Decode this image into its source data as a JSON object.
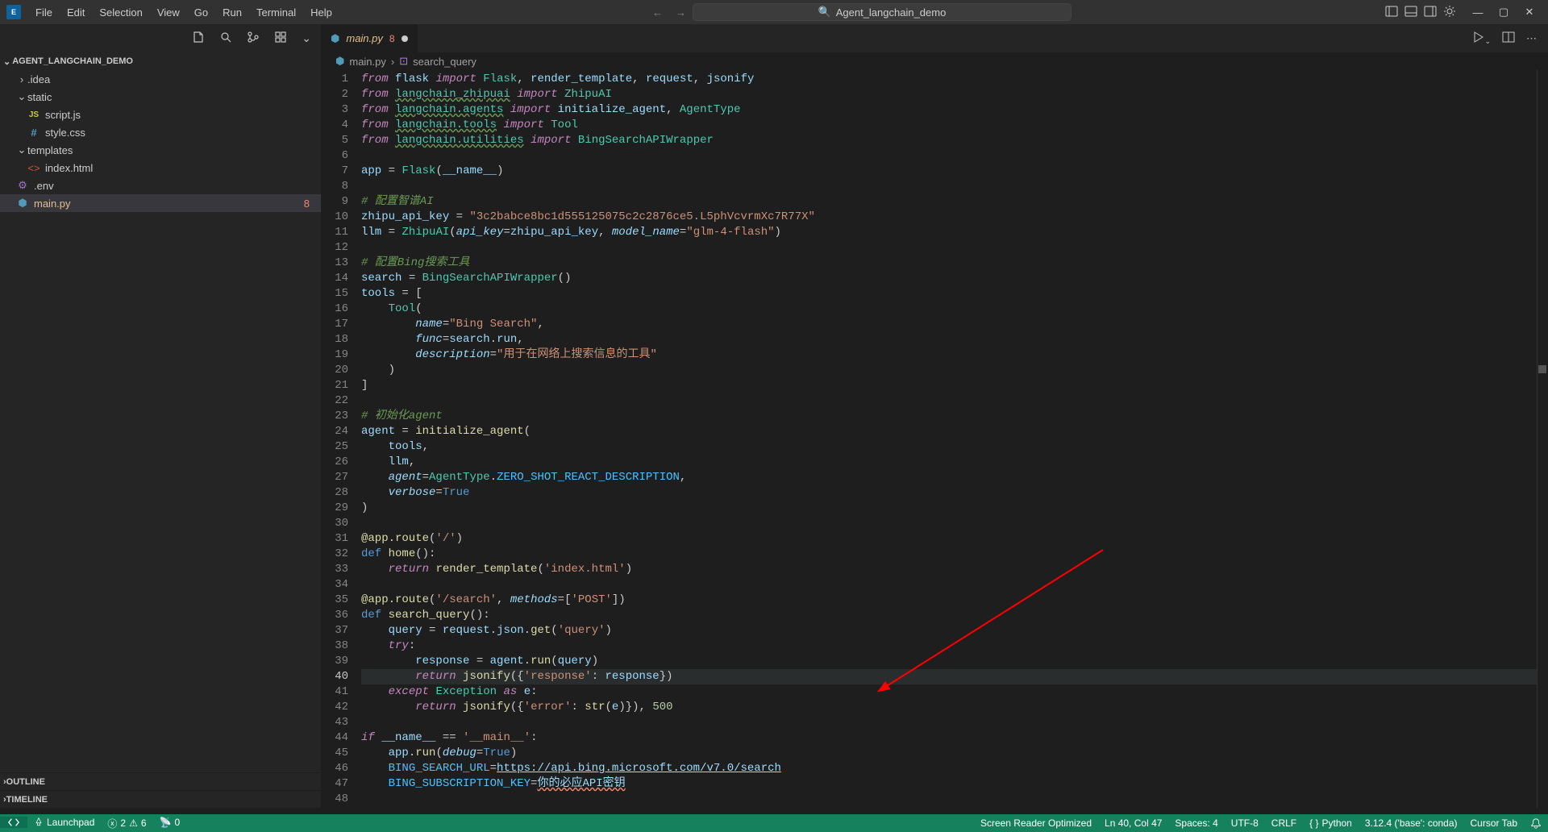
{
  "title_search": "Agent_langchain_demo",
  "menu": [
    "File",
    "Edit",
    "Selection",
    "View",
    "Go",
    "Run",
    "Terminal",
    "Help"
  ],
  "explorer": {
    "project": "AGENT_LANGCHAIN_DEMO",
    "tree": [
      {
        "label": ".idea",
        "type": "folder",
        "depth": 1,
        "open": false
      },
      {
        "label": "static",
        "type": "folder",
        "depth": 1,
        "open": true
      },
      {
        "label": "script.js",
        "type": "js",
        "depth": 2
      },
      {
        "label": "style.css",
        "type": "css",
        "depth": 2
      },
      {
        "label": "templates",
        "type": "folder",
        "depth": 1,
        "open": true
      },
      {
        "label": "index.html",
        "type": "html",
        "depth": 2
      },
      {
        "label": ".env",
        "type": "env",
        "depth": 1,
        "leaf": true
      },
      {
        "label": "main.py",
        "type": "py",
        "depth": 1,
        "leaf": true,
        "active": true,
        "badge": "8"
      }
    ],
    "outline": "OUTLINE",
    "timeline": "TIMELINE"
  },
  "tab": {
    "name": "main.py",
    "problems": "8"
  },
  "breadcrumb": {
    "file": "main.py",
    "symbol": "search_query"
  },
  "code": [
    {
      "n": 1,
      "h": "<span class='kw'>from</span> <span class='var'>flask</span> <span class='kw'>import</span> <span class='cls'>Flask</span>, <span class='var'>render_template</span>, <span class='var'>request</span>, <span class='var'>jsonify</span>"
    },
    {
      "n": 2,
      "h": "<span class='kw'>from</span> <span class='mod'>langchain_zhipuai</span> <span class='kw'>import</span> <span class='cls'>ZhipuAI</span>"
    },
    {
      "n": 3,
      "h": "<span class='kw'>from</span> <span class='mod'>langchain.agents</span> <span class='kw'>import</span> <span class='var'>initialize_agent</span>, <span class='cls'>AgentType</span>"
    },
    {
      "n": 4,
      "h": "<span class='kw'>from</span> <span class='mod'>langchain.tools</span> <span class='kw'>import</span> <span class='cls'>Tool</span>"
    },
    {
      "n": 5,
      "h": "<span class='kw'>from</span> <span class='mod'>langchain.utilities</span> <span class='kw'>import</span> <span class='cls'>BingSearchAPIWrapper</span>"
    },
    {
      "n": 6,
      "h": ""
    },
    {
      "n": 7,
      "h": "<span class='var'>app</span> = <span class='cls'>Flask</span>(<span class='var'>__name__</span>)"
    },
    {
      "n": 8,
      "h": ""
    },
    {
      "n": 9,
      "h": "<span class='com'># 配置智谱AI</span>"
    },
    {
      "n": 10,
      "h": "<span class='var'>zhipu_api_key</span> = <span class='str'>\"3c2babce8bc1d555125075c2c2876ce5.L5phVcvrmXc7R77X\"</span>"
    },
    {
      "n": 11,
      "h": "<span class='var'>llm</span> = <span class='cls'>ZhipuAI</span>(<span class='param'>api_key</span>=<span class='var'>zhipu_api_key</span>, <span class='param'>model_name</span>=<span class='str'>\"glm-4-flash\"</span>)"
    },
    {
      "n": 12,
      "h": ""
    },
    {
      "n": 13,
      "h": "<span class='com'># 配置Bing搜索工具</span>"
    },
    {
      "n": 14,
      "h": "<span class='var'>search</span> = <span class='cls'>BingSearchAPIWrapper</span>()"
    },
    {
      "n": 15,
      "h": "<span class='var'>tools</span> = ["
    },
    {
      "n": 16,
      "h": "    <span class='cls'>Tool</span>("
    },
    {
      "n": 17,
      "h": "        <span class='param'>name</span>=<span class='str'>\"Bing Search\"</span>,"
    },
    {
      "n": 18,
      "h": "        <span class='param'>func</span>=<span class='var'>search</span>.<span class='var'>run</span>,"
    },
    {
      "n": 19,
      "h": "        <span class='param'>description</span>=<span class='str'>\"用于在网络上搜索信息的工具\"</span>"
    },
    {
      "n": 20,
      "h": "    )"
    },
    {
      "n": 21,
      "h": "]"
    },
    {
      "n": 22,
      "h": ""
    },
    {
      "n": 23,
      "h": "<span class='com'># 初始化agent</span>"
    },
    {
      "n": 24,
      "h": "<span class='var'>agent</span> = <span class='fn'>initialize_agent</span>("
    },
    {
      "n": 25,
      "h": "    <span class='var'>tools</span>,"
    },
    {
      "n": 26,
      "h": "    <span class='var'>llm</span>,"
    },
    {
      "n": 27,
      "h": "    <span class='param'>agent</span>=<span class='cls'>AgentType</span>.<span class='const'>ZERO_SHOT_REACT_DESCRIPTION</span>,"
    },
    {
      "n": 28,
      "h": "    <span class='param'>verbose</span>=<span class='kw2'>True</span>"
    },
    {
      "n": 29,
      "h": ")"
    },
    {
      "n": 30,
      "h": ""
    },
    {
      "n": 31,
      "h": "<span class='fn'>@app.route</span>(<span class='str'>'/'</span>)"
    },
    {
      "n": 32,
      "h": "<span class='kw2'>def</span> <span class='fn'>home</span>():"
    },
    {
      "n": 33,
      "h": "    <span class='kw'>return</span> <span class='fn'>render_template</span>(<span class='str'>'index.html'</span>)"
    },
    {
      "n": 34,
      "h": ""
    },
    {
      "n": 35,
      "h": "<span class='fn'>@app.route</span>(<span class='str'>'/search'</span>, <span class='param'>methods</span>=[<span class='str'>'POST'</span>])"
    },
    {
      "n": 36,
      "h": "<span class='kw2'>def</span> <span class='fn'>search_query</span>():"
    },
    {
      "n": 37,
      "h": "    <span class='var'>query</span> = <span class='var'>request</span>.<span class='var'>json</span>.<span class='fn'>get</span>(<span class='str'>'query'</span>)"
    },
    {
      "n": 38,
      "h": "    <span class='kw'>try</span>:"
    },
    {
      "n": 39,
      "h": "        <span class='var'>response</span> = <span class='var'>agent</span>.<span class='fn'>run</span>(<span class='var'>query</span>)"
    },
    {
      "n": 40,
      "h": "        <span class='kw'>return</span> <span class='fn'>jsonify</span>({<span class='str'>'response'</span>: <span class='var'>response</span>})",
      "cur": true
    },
    {
      "n": 41,
      "h": "    <span class='kw'>except</span> <span class='cls'>Exception</span> <span class='kw'>as</span> <span class='var'>e</span>:"
    },
    {
      "n": 42,
      "h": "        <span class='kw'>return</span> <span class='fn'>jsonify</span>({<span class='str'>'error'</span>: <span class='fn'>str</span>(<span class='var'>e</span>)}), <span class='num'>500</span>"
    },
    {
      "n": 43,
      "h": ""
    },
    {
      "n": 44,
      "h": "<span class='kw'>if</span> <span class='var'>__name__</span> == <span class='str'>'__main__'</span>:"
    },
    {
      "n": 45,
      "h": "    <span class='var'>app</span>.<span class='fn'>run</span>(<span class='param'>debug</span>=<span class='kw2'>True</span>)"
    },
    {
      "n": 46,
      "h": "    <span class='const'>BING_SEARCH_URL</span>=<span class='var url-underline'>https://api.bing.microsoft.com/v7.0/search</span>"
    },
    {
      "n": 47,
      "h": "    <span class='const'>BING_SUBSCRIPTION_KEY</span>=<span class='var squiggle-err'>你的必应API密钥</span>"
    },
    {
      "n": 48,
      "h": ""
    }
  ],
  "status": {
    "launchpad": "Launchpad",
    "errors": "2",
    "warnings": "6",
    "ports": "0",
    "reader": "Screen Reader Optimized",
    "pos": "Ln 40, Col 47",
    "spaces": "Spaces: 4",
    "encoding": "UTF-8",
    "eol": "CRLF",
    "lang": "Python",
    "interp": "3.12.4 ('base': conda)",
    "cursortab": "Cursor Tab"
  }
}
